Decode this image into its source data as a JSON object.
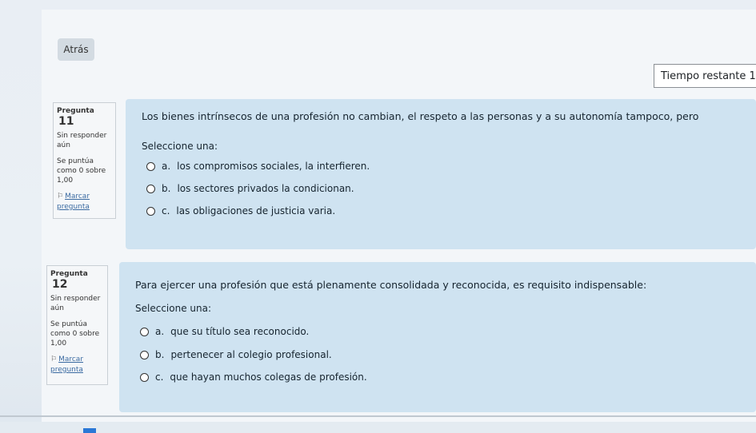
{
  "nav": {
    "back_label": "Atrás"
  },
  "timer": {
    "label": "Tiempo restante 1"
  },
  "questions": [
    {
      "info": {
        "prefix": "Pregunta",
        "number": "11",
        "status": "Sin responder aún",
        "grade": "Se puntúa como 0 sobre 1,00",
        "flag_label": "Marcar pregunta"
      },
      "text": "Los bienes intrínsecos de una profesión no cambian, el respeto a las personas y a su autonomía tampoco, pero",
      "prompt": "Seleccione una:",
      "options": [
        {
          "letter": "a.",
          "text": "los compromisos sociales, la interfieren."
        },
        {
          "letter": "b.",
          "text": "los sectores privados la condicionan."
        },
        {
          "letter": "c.",
          "text": "las obligaciones de justicia varia."
        }
      ]
    },
    {
      "info": {
        "prefix": "Pregunta",
        "number": "12",
        "status": "Sin responder aún",
        "grade": "Se puntúa como 0 sobre 1,00",
        "flag_label": "Marcar pregunta"
      },
      "text": "Para ejercer una profesión que está plenamente consolidada y reconocida, es requisito indispensable:",
      "prompt": "Seleccione una:",
      "options": [
        {
          "letter": "a.",
          "text": "que su título sea reconocido."
        },
        {
          "letter": "b.",
          "text": "pertenecer al colegio profesional."
        },
        {
          "letter": "c.",
          "text": "que hayan muchos colegas de profesión."
        }
      ]
    }
  ]
}
